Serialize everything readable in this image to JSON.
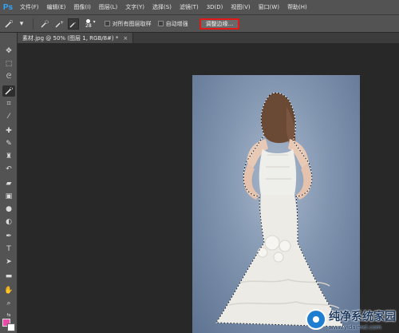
{
  "app": {
    "logo": "Ps"
  },
  "menu": [
    "文件(F)",
    "编辑(E)",
    "图像(I)",
    "图层(L)",
    "文字(Y)",
    "选择(S)",
    "滤镜(T)",
    "3D(D)",
    "视图(V)",
    "窗口(W)",
    "帮助(H)"
  ],
  "options": {
    "brush_size": "28",
    "sample_all_layers_label": "对所有图层取样",
    "auto_enhance_label": "自动增强",
    "refine_edge_label": "调整边缘..."
  },
  "document": {
    "tab_title": "素材.jpg @ 50% (图层 1, RGB/8#) *",
    "tab_close": "×"
  },
  "colors": {
    "foreground": "#e84aa8",
    "background": "#ffffff",
    "highlight": "#e01818"
  },
  "tools": [
    "move-icon",
    "marquee-icon",
    "lasso-icon",
    "quick-selection-icon",
    "crop-icon",
    "eyedropper-icon",
    "healing-brush-icon",
    "brush-icon",
    "clone-stamp-icon",
    "history-brush-icon",
    "eraser-icon",
    "gradient-icon",
    "blur-icon",
    "dodge-icon",
    "pen-icon",
    "type-icon",
    "path-selection-icon",
    "rectangle-icon",
    "hand-icon",
    "zoom-icon"
  ],
  "watermark": {
    "title": "纯净系统家园",
    "url": "www.yidaimei.com"
  }
}
